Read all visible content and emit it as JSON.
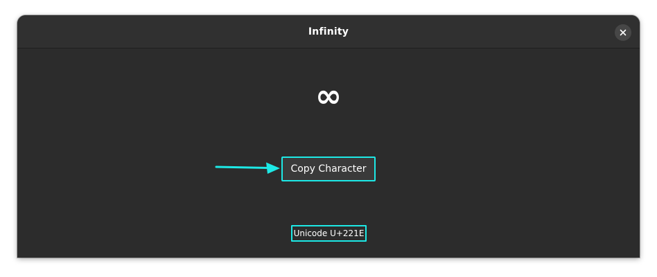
{
  "window": {
    "title": "Infinity"
  },
  "character": {
    "glyph": "∞",
    "unicode_label": "Unicode U+221E"
  },
  "actions": {
    "copy_label": "Copy Character"
  },
  "icons": {
    "close": "close-icon",
    "annotation_arrow": "arrow-right-icon"
  },
  "colors": {
    "window_bg": "#2c2c2c",
    "titlebar_bg": "#303030",
    "highlight": "#1de9e6",
    "text": "#ffffff"
  }
}
